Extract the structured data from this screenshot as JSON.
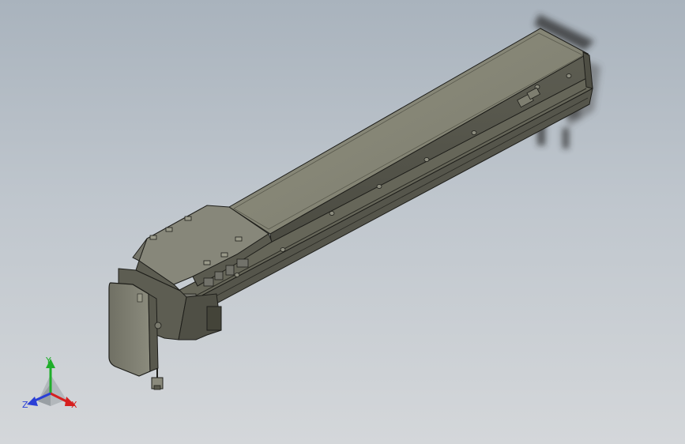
{
  "viewport": {
    "background_top": "#a9b3bd",
    "background_bottom": "#d4d7da"
  },
  "model": {
    "name": "linear-actuator-assembly",
    "body_color": "#6e6e62",
    "face_color": "#8a8a7c",
    "edge_color": "#1e1e1a"
  },
  "triad": {
    "x_label": "X",
    "y_label": "Y",
    "z_label": "Z",
    "x_color": "#d61f1f",
    "y_color": "#1fae2a",
    "z_color": "#2a3fd6"
  }
}
